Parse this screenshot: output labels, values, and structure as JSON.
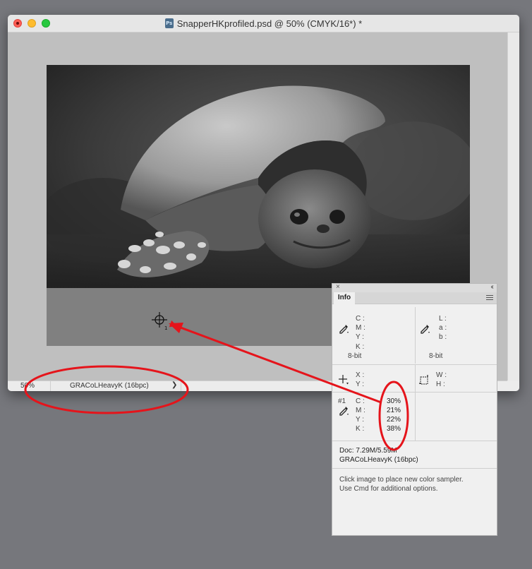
{
  "window": {
    "title": "SnapperHKprofiled.psd @ 50% (CMYK/16*) *",
    "app_icon_label": "Ps"
  },
  "statusbar": {
    "zoom": "50%",
    "profile": "GRACoLHeavyK (16bpc)",
    "arrow": "❯"
  },
  "info_panel": {
    "close": "×",
    "collapse": "‹‹",
    "tab": "Info",
    "cmyk_labels": [
      "C :",
      "M :",
      "Y :",
      "K :"
    ],
    "cmyk_bit": "8-bit",
    "lab_labels": [
      "L :",
      "a :",
      "b :"
    ],
    "lab_bit": "8-bit",
    "xy_labels": [
      "X :",
      "Y :"
    ],
    "wh_labels": [
      "W :",
      "H :"
    ],
    "sampler": {
      "number": "#1",
      "labels": [
        "C :",
        "M :",
        "Y :",
        "K :"
      ],
      "values": [
        "30%",
        "21%",
        "22%",
        "38%"
      ]
    },
    "doc": "Doc: 7.29M/5.59M",
    "doc_profile": "GRACoLHeavyK (16bpc)",
    "hint_line1": "Click image to place new color sampler.",
    "hint_line2": "Use Cmd for additional options."
  },
  "annotation_color": "#e5141b"
}
